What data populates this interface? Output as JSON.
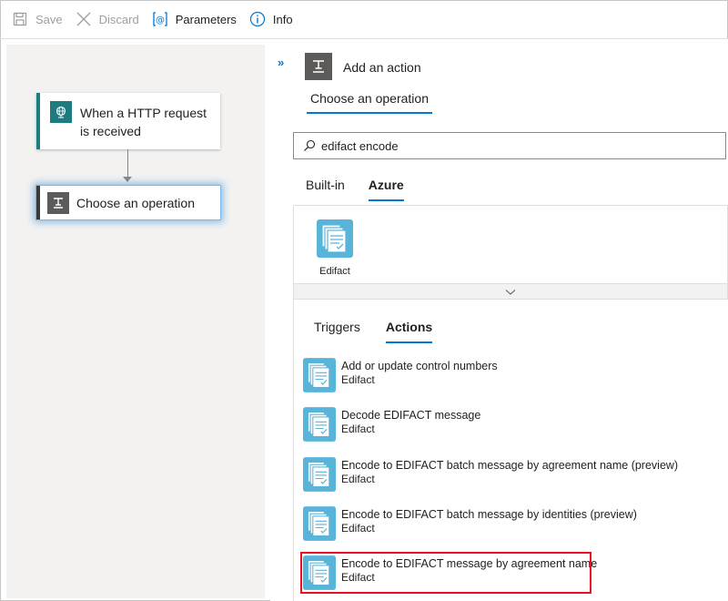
{
  "toolbar": {
    "save_label": "Save",
    "discard_label": "Discard",
    "parameters_label": "Parameters",
    "info_label": "Info"
  },
  "canvas": {
    "trigger_card_title": "When a HTTP request is received",
    "action_card_title": "Choose an operation"
  },
  "panel": {
    "header_title": "Add an action",
    "operation_tab": "Choose an operation",
    "search_value": "edifact encode",
    "connector_tabs": [
      "Built-in",
      "Azure"
    ],
    "active_connector_tab": "Azure",
    "connector_tile_label": "Edifact",
    "result_tabs": [
      "Triggers",
      "Actions"
    ],
    "active_result_tab": "Actions",
    "actions": [
      {
        "name": "Add or update control numbers",
        "connector": "Edifact"
      },
      {
        "name": "Decode EDIFACT message",
        "connector": "Edifact"
      },
      {
        "name": "Encode to EDIFACT batch message by agreement name (preview)",
        "connector": "Edifact"
      },
      {
        "name": "Encode to EDIFACT batch message by identities (preview)",
        "connector": "Edifact"
      },
      {
        "name": "Encode to EDIFACT message by agreement name",
        "connector": "Edifact"
      }
    ]
  },
  "colors": {
    "accent": "#0078d4",
    "highlight": "#e81123",
    "trigger": "#1c7c80",
    "edifact": "#59b4d9"
  },
  "icons": {
    "save": "save-icon",
    "discard": "discard-icon",
    "parameters": "parameters-icon",
    "info": "info-icon",
    "search": "search-icon",
    "edifact": "edifact-icon"
  }
}
